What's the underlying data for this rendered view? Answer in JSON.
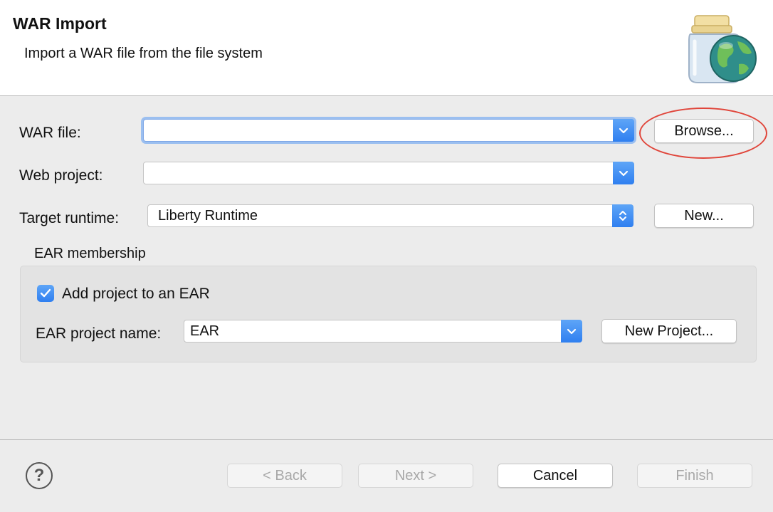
{
  "header": {
    "title": "WAR Import",
    "subtitle": "Import a WAR file from the file system",
    "icon": "war-jar-globe-icon"
  },
  "form": {
    "war_file": {
      "label": "WAR file:",
      "value": "",
      "browse_label": "Browse..."
    },
    "web_project": {
      "label": "Web project:",
      "value": ""
    },
    "target_runtime": {
      "label": "Target runtime:",
      "value": "Liberty Runtime",
      "new_label": "New..."
    }
  },
  "ear": {
    "group_label": "EAR membership",
    "add_checkbox_label": "Add project to an EAR",
    "add_checked": true,
    "project_name_label": "EAR project name:",
    "project_name_value": "EAR",
    "new_project_label": "New Project..."
  },
  "annotation": {
    "color": "#e0453a",
    "target": "browse-button"
  },
  "footer": {
    "help_icon": "help-icon",
    "back_label": "< Back",
    "next_label": "Next >",
    "cancel_label": "Cancel",
    "finish_label": "Finish"
  },
  "colors": {
    "accent": "#2f7ff0",
    "annotation": "#e0453a"
  }
}
